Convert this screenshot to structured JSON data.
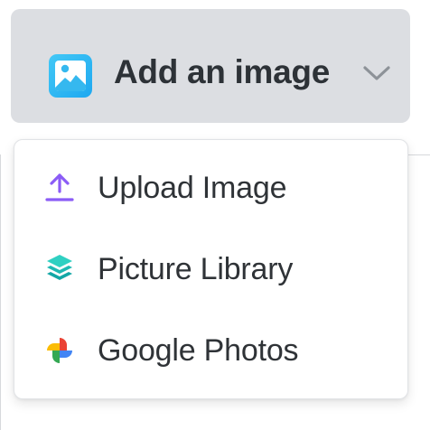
{
  "dropdown": {
    "label": "Add an image",
    "icon": "image-icon",
    "chevron_icon": "chevron-down-icon",
    "state": "open"
  },
  "menu": {
    "items": [
      {
        "label": "Upload Image",
        "icon": "upload-icon",
        "color": "#8b5cf6"
      },
      {
        "label": "Picture Library",
        "icon": "layers-icon",
        "color": "#22c8b8"
      },
      {
        "label": "Google Photos",
        "icon": "google-photos-icon",
        "colors": [
          "#ea4335",
          "#fbbc05",
          "#34a853",
          "#4285f4"
        ]
      }
    ]
  },
  "colors": {
    "trigger_bg": "#dcdee2",
    "text": "#2f3337",
    "menu_border": "#e1e3e6"
  }
}
